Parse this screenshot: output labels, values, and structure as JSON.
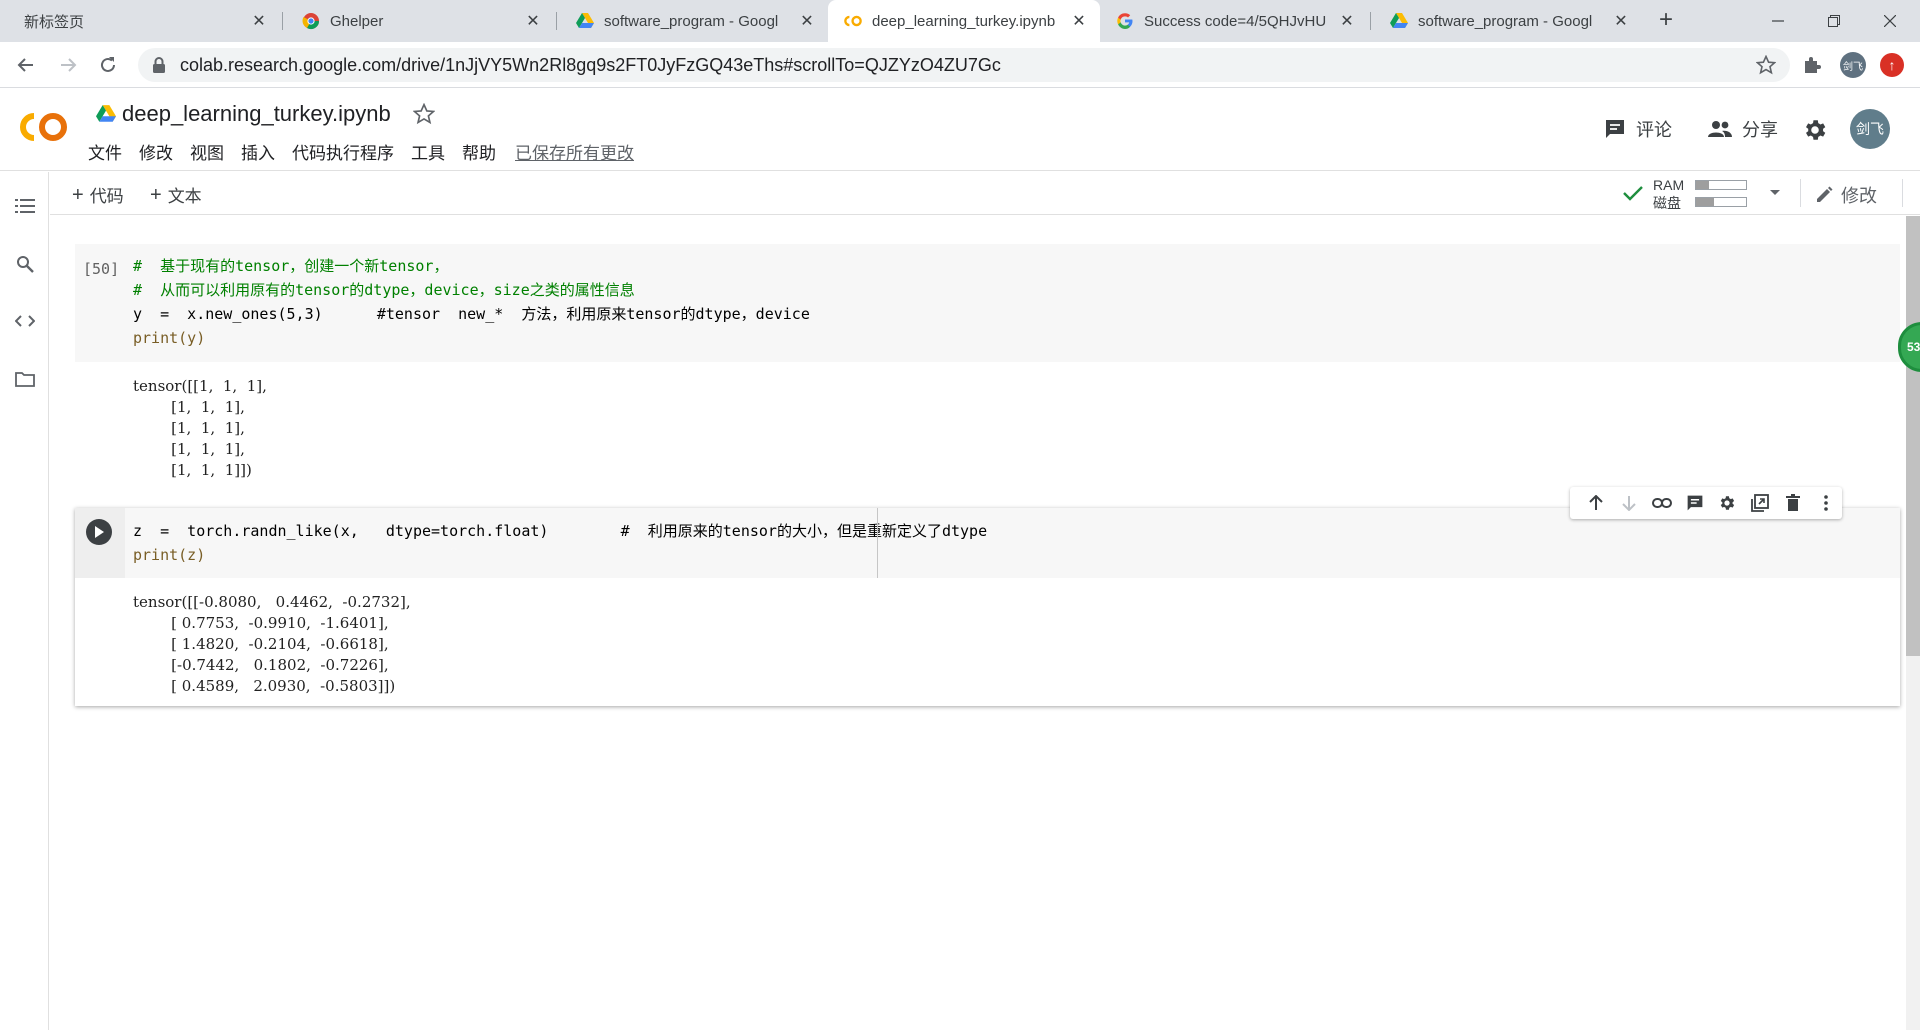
{
  "browser": {
    "tabs": [
      {
        "title": "新标签页",
        "close": "✕"
      },
      {
        "title": "Ghelper",
        "close": "✕"
      },
      {
        "title": "software_program - Googl",
        "close": "✕"
      },
      {
        "title": "deep_learning_turkey.ipynb",
        "close": "✕"
      },
      {
        "title": "Success code=4/5QHJvHU",
        "close": "✕"
      },
      {
        "title": "software_program - Googl",
        "close": "✕"
      }
    ],
    "new_tab": "+",
    "url": "colab.research.google.com/drive/1nJjVY5Wn2Rl8gq9s2FT0JyFzGQ43eThs#scrollTo=QJZYzO4ZU7Gc",
    "profile_label": "剑飞",
    "update_label": "↑"
  },
  "colab": {
    "notebook_title": "deep_learning_turkey.ipynb",
    "menu": [
      "文件",
      "修改",
      "视图",
      "插入",
      "代码执行程序",
      "工具",
      "帮助"
    ],
    "saved_status": "已保存所有更改",
    "comment_label": "评论",
    "share_label": "分享",
    "avatar_label": "剑飞",
    "add_code_label": "代码",
    "add_text_label": "文本",
    "ram_label": "RAM",
    "disk_label": "磁盘",
    "ram_usage": 0.25,
    "disk_usage": 0.35,
    "edit_label": "修改",
    "side_badge": "53"
  },
  "cells": [
    {
      "exec_count": "[50]",
      "code": [
        "#  基于现有的tensor，创建一个新tensor，",
        "#  从而可以利用原有的tensor的dtype，device，size之类的属性信息",
        "y  =  x.new_ones(5,3)      #tensor  new_*  方法，利用原来tensor的dtype，device",
        "print(y)"
      ],
      "output": [
        "tensor([[1,  1,  1],",
        "        [1,  1,  1],",
        "        [1,  1,  1],",
        "        [1,  1,  1],",
        "        [1,  1,  1]])"
      ]
    },
    {
      "exec_count": "",
      "code": [
        "z  =  torch.randn_like(x,   dtype=torch.float)        #  利用原来的tensor的大小，但是重新定义了dtype",
        "print(z)"
      ],
      "output": [
        "tensor([[-0.8080,   0.4462,  -0.2732],",
        "        [ 0.7753,  -0.9910,  -1.6401],",
        "        [ 1.4820,  -0.2104,  -0.6618],",
        "        [-0.7442,   0.1802,  -0.7226],",
        "        [ 0.4589,   2.0930,  -0.5803]])"
      ]
    }
  ],
  "colors": {
    "colab_orange": "#f9ab00",
    "check_green": "#1e8e3e",
    "comment_green": "#008000"
  }
}
